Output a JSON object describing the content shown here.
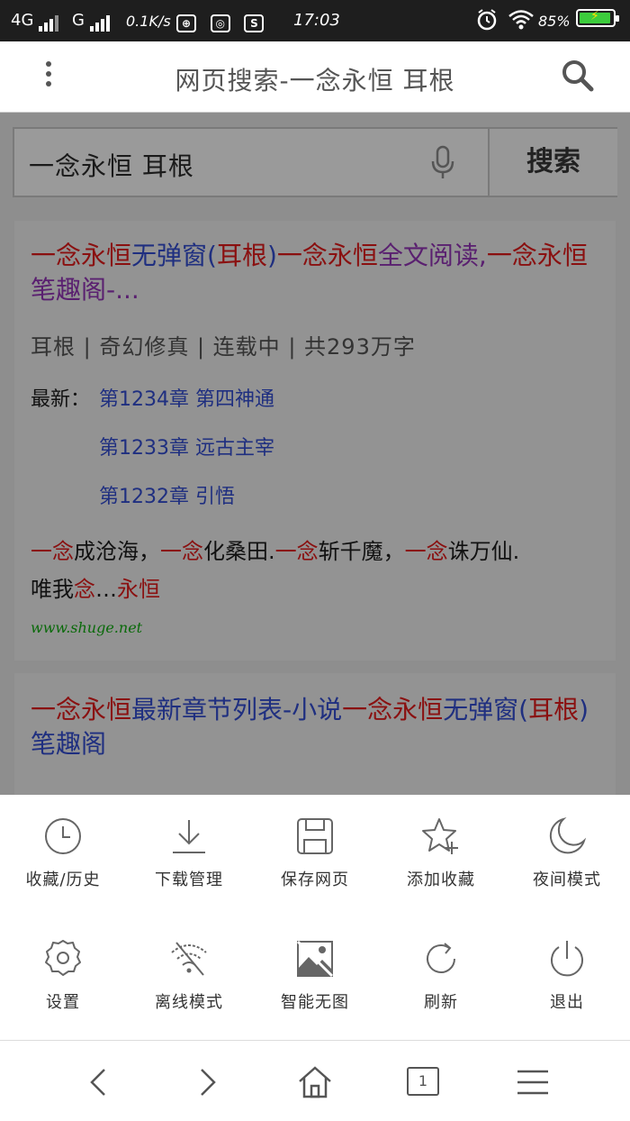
{
  "status_bar": {
    "signal1": "4G",
    "signal2": "G",
    "speed": "0.1K/s",
    "time": "17:03",
    "battery": "85%"
  },
  "title_bar": {
    "title": "网页搜索-一念永恒 耳根"
  },
  "search": {
    "query": "一念永恒 耳根",
    "button": "搜索"
  },
  "results": [
    {
      "title_parts": [
        "一念永恒",
        "无弹窗(",
        "耳根",
        ")",
        "一念永恒",
        "全文阅读,",
        "一念永恒",
        "笔趣阁-..."
      ],
      "meta": "耳根 | 奇幻修真 | 连载中 | 共293万字",
      "latest_label": "最新：",
      "chapters": [
        "第1234章 第四神通",
        "第1233章 远古主宰",
        "第1232章 引悟"
      ],
      "desc_parts": [
        "一念",
        "成沧海，",
        "一念",
        "化桑田.",
        "一念",
        "斩千魔，",
        "一念",
        "诛万仙.",
        "唯我",
        "念",
        "…",
        "永恒"
      ],
      "url": "www.shuge.net"
    },
    {
      "title_parts": [
        "一念永恒",
        "最新章节列表-小说",
        "一念永恒",
        "无弹",
        "窗(",
        "耳根",
        ")笔趣阁"
      ]
    }
  ],
  "menu": {
    "row1": [
      {
        "label": "收藏/历史",
        "icon": "clock-icon"
      },
      {
        "label": "下载管理",
        "icon": "download-icon"
      },
      {
        "label": "保存网页",
        "icon": "save-icon"
      },
      {
        "label": "添加收藏",
        "icon": "star-plus-icon"
      },
      {
        "label": "夜间模式",
        "icon": "moon-icon"
      }
    ],
    "row2": [
      {
        "label": "设置",
        "icon": "gear-icon"
      },
      {
        "label": "离线模式",
        "icon": "wifi-off-icon"
      },
      {
        "label": "智能无图",
        "icon": "no-image-icon"
      },
      {
        "label": "刷新",
        "icon": "refresh-icon"
      },
      {
        "label": "退出",
        "icon": "power-icon"
      }
    ]
  },
  "navbar": {
    "tab_count": "1"
  }
}
